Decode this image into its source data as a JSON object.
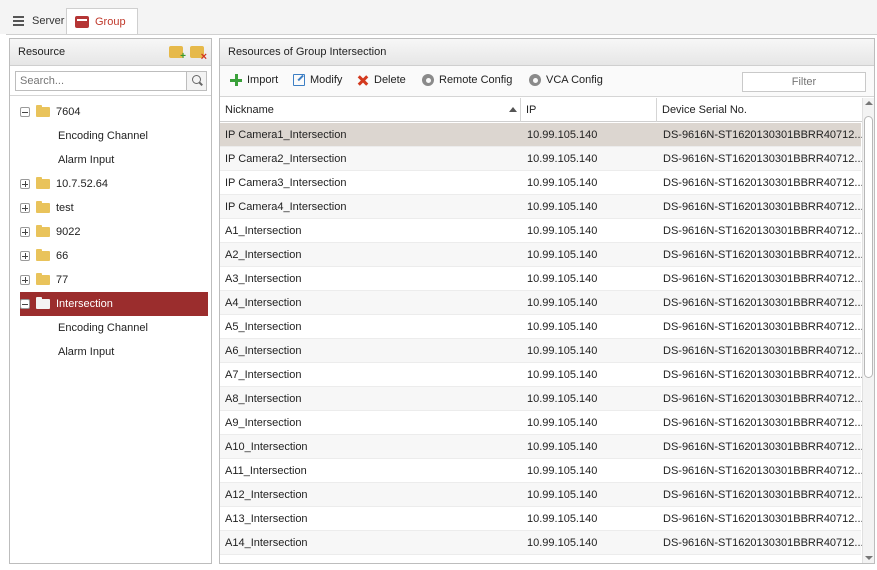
{
  "tabs": [
    {
      "label": "Server",
      "icon": "server-list-icon",
      "active": false
    },
    {
      "label": "Group",
      "icon": "group-icon",
      "active": true
    }
  ],
  "resource_panel": {
    "title": "Resource",
    "search_placeholder": "Search...",
    "tree": [
      {
        "label": "7604",
        "expanded": true,
        "selected": false
      },
      {
        "label": "Encoding Channel",
        "leaf": true
      },
      {
        "label": "Alarm Input",
        "leaf": true
      },
      {
        "label": "10.7.52.64",
        "expanded": false,
        "selected": false
      },
      {
        "label": "test",
        "expanded": false,
        "selected": false
      },
      {
        "label": "9022",
        "expanded": false,
        "selected": false
      },
      {
        "label": "66",
        "expanded": false,
        "selected": false
      },
      {
        "label": "77",
        "expanded": false,
        "selected": false
      },
      {
        "label": "Intersection",
        "expanded": true,
        "selected": true
      },
      {
        "label": "Encoding Channel",
        "leaf": true
      },
      {
        "label": "Alarm Input",
        "leaf": true
      }
    ]
  },
  "group_panel": {
    "title": "Resources of Group Intersection",
    "toolbar": {
      "import_label": "Import",
      "modify_label": "Modify",
      "delete_label": "Delete",
      "remote_config_label": "Remote Config",
      "vca_config_label": "VCA Config",
      "filter_placeholder": "Filter"
    },
    "columns": [
      "Nickname",
      "IP",
      "Device Serial No."
    ],
    "rows": [
      [
        "IP Camera1_Intersection",
        "10.99.105.140",
        "DS-9616N-ST1620130301BBRR40712..."
      ],
      [
        "IP Camera2_Intersection",
        "10.99.105.140",
        "DS-9616N-ST1620130301BBRR40712..."
      ],
      [
        "IP Camera3_Intersection",
        "10.99.105.140",
        "DS-9616N-ST1620130301BBRR40712..."
      ],
      [
        "IP Camera4_Intersection",
        "10.99.105.140",
        "DS-9616N-ST1620130301BBRR40712..."
      ],
      [
        "A1_Intersection",
        "10.99.105.140",
        "DS-9616N-ST1620130301BBRR40712..."
      ],
      [
        "A2_Intersection",
        "10.99.105.140",
        "DS-9616N-ST1620130301BBRR40712..."
      ],
      [
        "A3_Intersection",
        "10.99.105.140",
        "DS-9616N-ST1620130301BBRR40712..."
      ],
      [
        "A4_Intersection",
        "10.99.105.140",
        "DS-9616N-ST1620130301BBRR40712..."
      ],
      [
        "A5_Intersection",
        "10.99.105.140",
        "DS-9616N-ST1620130301BBRR40712..."
      ],
      [
        "A6_Intersection",
        "10.99.105.140",
        "DS-9616N-ST1620130301BBRR40712..."
      ],
      [
        "A7_Intersection",
        "10.99.105.140",
        "DS-9616N-ST1620130301BBRR40712..."
      ],
      [
        "A8_Intersection",
        "10.99.105.140",
        "DS-9616N-ST1620130301BBRR40712..."
      ],
      [
        "A9_Intersection",
        "10.99.105.140",
        "DS-9616N-ST1620130301BBRR40712..."
      ],
      [
        "A10_Intersection",
        "10.99.105.140",
        "DS-9616N-ST1620130301BBRR40712..."
      ],
      [
        "A11_Intersection",
        "10.99.105.140",
        "DS-9616N-ST1620130301BBRR40712..."
      ],
      [
        "A12_Intersection",
        "10.99.105.140",
        "DS-9616N-ST1620130301BBRR40712..."
      ],
      [
        "A13_Intersection",
        "10.99.105.140",
        "DS-9616N-ST1620130301BBRR40712..."
      ],
      [
        "A14_Intersection",
        "10.99.105.140",
        "DS-9616N-ST1620130301BBRR40712..."
      ]
    ],
    "selected_row": 0
  },
  "colors": {
    "accent": "#9b2d2d",
    "tab_active_text": "#c0392b",
    "selected_row": "#dcd6d0"
  }
}
